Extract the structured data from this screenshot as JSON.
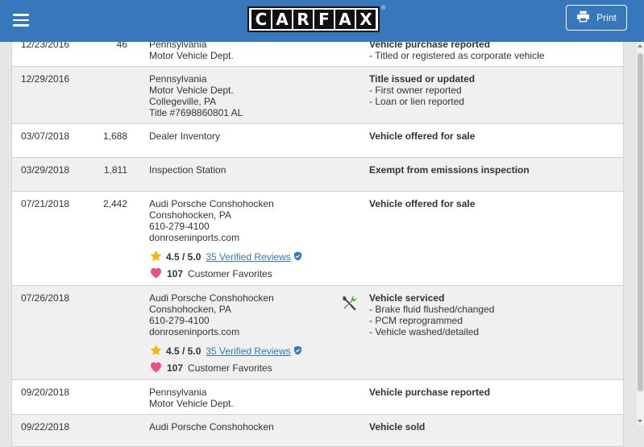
{
  "header": {
    "logo_letters": [
      "C",
      "A",
      "R",
      "F",
      "A",
      "X"
    ],
    "logo_reg": "®",
    "print_label": "Print",
    "brand_color": "#3777bc"
  },
  "rows": [
    {
      "date": "12/23/2016",
      "odometer": "46",
      "source_lines": [
        "Pennsylvania",
        "Motor Vehicle Dept."
      ],
      "comment_title": "Vehicle purchase reported",
      "comment_lines": [
        "- Titled or registered as corporate vehicle"
      ]
    },
    {
      "date": "12/29/2016",
      "odometer": "",
      "source_lines": [
        "Pennsylvania",
        "Motor Vehicle Dept.",
        "Collegeville, PA",
        "Title #7698860801 AL"
      ],
      "comment_title": "Title issued or updated",
      "comment_lines": [
        "- First owner reported",
        "- Loan or lien reported"
      ]
    },
    {
      "date": "03/07/2018",
      "odometer": "1,688",
      "source_lines": [
        "Dealer Inventory"
      ],
      "comment_title": "Vehicle offered for sale",
      "comment_lines": []
    },
    {
      "date": "03/29/2018",
      "odometer": "1,811",
      "source_lines": [
        "Inspection Station"
      ],
      "comment_title": "Exempt from emissions inspection",
      "comment_lines": []
    },
    {
      "date": "07/21/2018",
      "odometer": "2,442",
      "source_lines": [
        "Audi Porsche Conshohocken",
        "Conshohocken, PA",
        "610-279-4100",
        "donroseninports.com"
      ],
      "rating": "4.5 / 5.0",
      "reviews": "35 Verified Reviews",
      "favorites_count": "107",
      "favorites_label": "Customer Favorites",
      "comment_title": "Vehicle offered for sale",
      "comment_lines": []
    },
    {
      "date": "07/26/2018",
      "odometer": "",
      "source_lines": [
        "Audi Porsche Conshohocken",
        "Conshohocken, PA",
        "610-279-4100",
        "donroseninports.com"
      ],
      "rating": "4.5 / 5.0",
      "reviews": "35 Verified Reviews",
      "favorites_count": "107",
      "favorites_label": "Customer Favorites",
      "comment_icon": "service-tools-icon",
      "comment_title": "Vehicle serviced",
      "comment_lines": [
        "- Brake fluid flushed/changed",
        "- PCM reprogrammed",
        "- Vehicle washed/detailed"
      ]
    },
    {
      "date": "09/20/2018",
      "odometer": "",
      "source_lines": [
        "Pennsylvania",
        "Motor Vehicle Dept."
      ],
      "comment_title": "Vehicle purchase reported",
      "comment_lines": []
    },
    {
      "date": "09/22/2018",
      "odometer": "",
      "source_lines": [
        "Audi Porsche Conshohocken"
      ],
      "comment_title": "Vehicle sold",
      "comment_lines": []
    }
  ]
}
